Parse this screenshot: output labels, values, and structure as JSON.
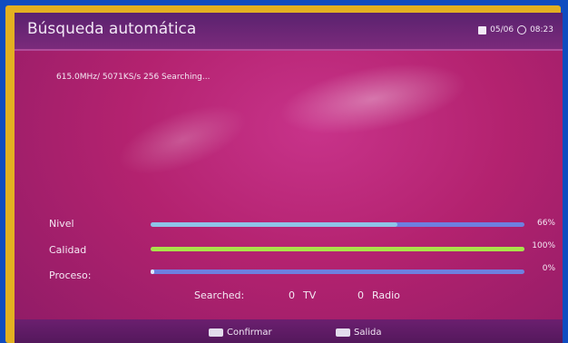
{
  "header": {
    "title": "Búsqueda automática",
    "date": "05/06",
    "time": "08:23"
  },
  "status": {
    "line": "615.0MHz/ 5071KS/s 256 Searching..."
  },
  "rows": [
    {
      "label": "Nivel",
      "value": 0.66,
      "percent_text": "66%"
    },
    {
      "label": "Calidad",
      "value": 1.0,
      "percent_text": "100%"
    },
    {
      "label": "Proceso:",
      "value": 0.0,
      "percent_text": "0%"
    }
  ],
  "searched": {
    "label": "Searched:",
    "tv_count": "0",
    "tv_label": "TV",
    "radio_count": "0",
    "radio_label": "Radio"
  },
  "footer": {
    "confirm_label": "Confirmar",
    "exit_label": "Salida"
  },
  "colors": {
    "background": "#b3226f",
    "level_bar": "#8ec3e8",
    "quality_bar": "#a9e24a",
    "track": "#6e7fe0"
  },
  "icons": {
    "date": "calendar-icon",
    "time": "clock-icon"
  }
}
